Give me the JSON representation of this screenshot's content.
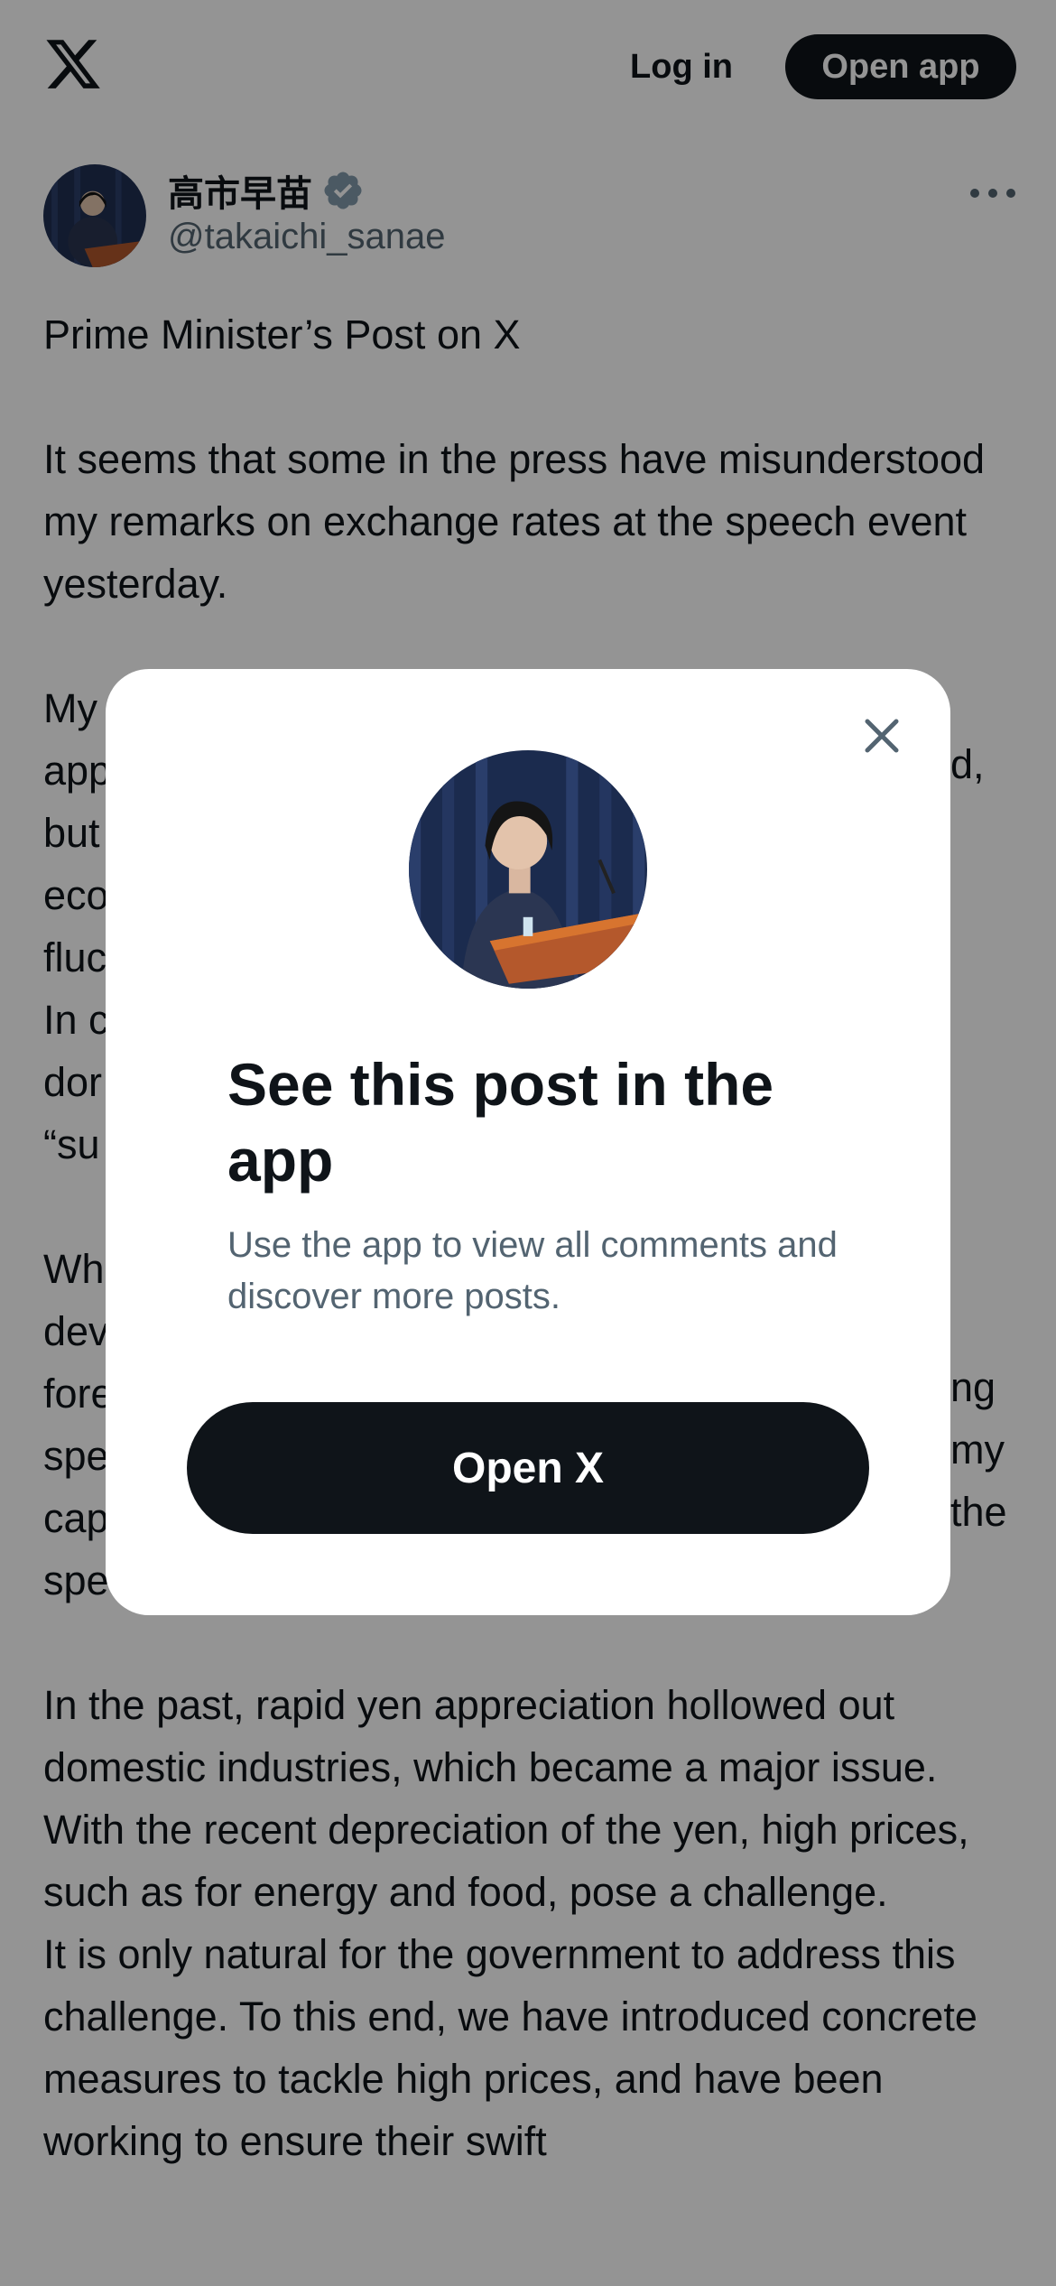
{
  "header": {
    "logo_icon": "x-logo-icon",
    "login_label": "Log in",
    "open_app_label": "Open app"
  },
  "post": {
    "author_name": "高市早苗",
    "author_handle": "@takaichi_sanae",
    "verified_icon": "verified-badge-icon",
    "more_icon": "more-horizontal-icon",
    "body": "Prime Minister’s Post on X\n\nIt seems that some in the press have misunderstood my remarks on exchange rates at the speech event yesterday.\n\nMy\napp\nbut\neco\nfluc\nIn c\ndor\n“su\n\nWh\ndev\nfore\nspe\ncap\nspe\n\nIn the past, rapid yen appreciation hollowed out domestic industries, which became a major issue.\nWith the recent depreciation of the yen, high prices, such as for energy and food, pose a challenge.\nIt is only natural for the government to address this challenge. To this end, we have introduced concrete measures to tackle high prices, and have been working to ensure their swift",
    "fragments_right": [
      "d,",
      "ng",
      "my",
      "the"
    ]
  },
  "modal": {
    "close_icon": "close-icon",
    "title": "See this post in the app",
    "subtitle": "Use the app to view all comments and discover more posts.",
    "button_label": "Open X"
  },
  "colors": {
    "primary_text": "#0f1419",
    "secondary_text": "#536471",
    "button_bg": "#0f1419",
    "overlay": "rgba(0,0,0,0.42)",
    "verified": "#829aab"
  }
}
